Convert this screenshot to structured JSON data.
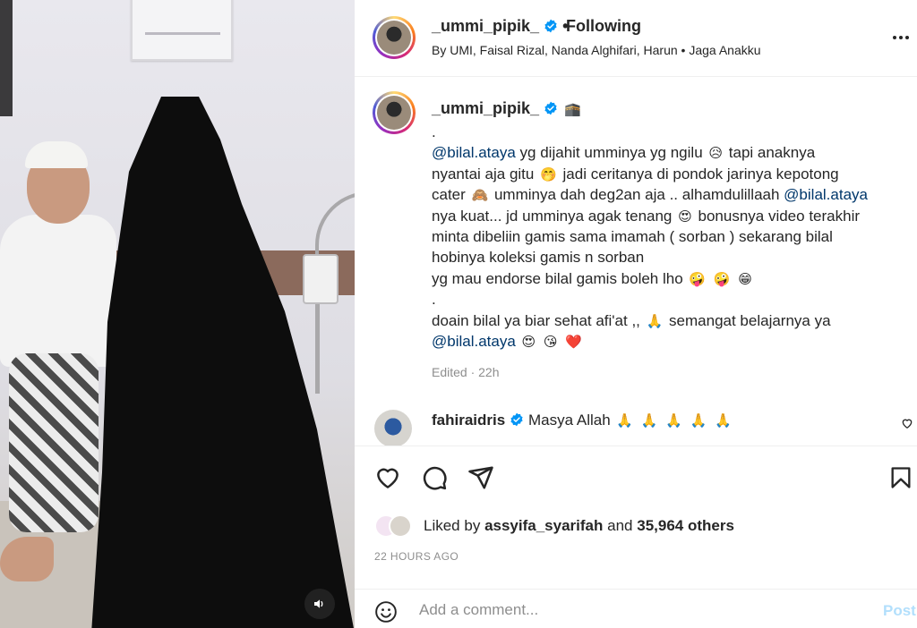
{
  "header": {
    "username": "_ummi_pipik_",
    "separator": "•",
    "follow_status": "Following",
    "subtitle": "By UMI, Faisal Rizal, Nanda Alghifari, Harun • Jaga Anakku",
    "more_icon": "more-horizontal-icon"
  },
  "caption": {
    "username": "_ummi_pipik_",
    "user_badge_emoji": "🕋",
    "lines": [
      ".",
      "yg dijahit umminya yg ngilu",
      "tapi anaknya",
      "nyantai aja gitu",
      "jadi ceritanya di pondok jarinya kepotong",
      "cater",
      "umminya dah deg2an aja .. alhamdulillaah",
      "nya kuat... jd umminya agak tenang",
      "bonusnya video terakhir",
      "minta dibeliin gamis sama imamah ( sorban ) sekarang bilal",
      "hobinya koleksi gamis n sorban",
      "yg mau endorse bilal gamis boleh lho",
      ".",
      "doain bilal ya biar sehat afi'at ,,",
      "semangat belajarnya ya"
    ],
    "mention": "@bilal.ataya",
    "emojis": {
      "sad": "😥",
      "thinking": "🤭",
      "monkey": "🙈",
      "love": "😍",
      "silly": "🤪",
      "grin": "😁",
      "pray": "🙏",
      "kiss": "😘",
      "heart": "❤️"
    },
    "edited": "Edited · 22h"
  },
  "comment": {
    "username": "fahiraidris",
    "text": "Masya Allah",
    "emoji": "🙏"
  },
  "actions": {
    "liked_by_prefix": "Liked by",
    "liked_by_user": "assyifa_syarifah",
    "liked_and": "and",
    "liked_others": "35,964 others",
    "time_ago": "22 HOURS AGO"
  },
  "comment_box": {
    "placeholder": "Add a comment...",
    "post_label": "Post"
  },
  "colors": {
    "mention": "#00376b",
    "verified": "#0095f6",
    "post_disabled": "#b2dffc",
    "heart": "#ed4956"
  }
}
